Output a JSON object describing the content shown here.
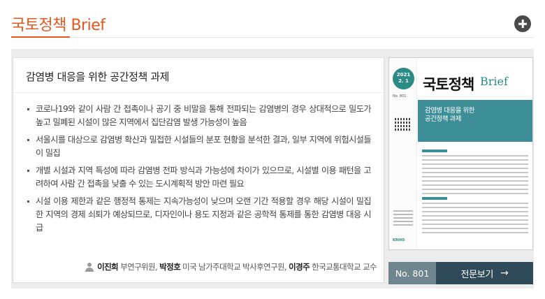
{
  "header": {
    "brand": "국토정책 Brief",
    "more_button": "+"
  },
  "article": {
    "title": "감염병 대응을 위한 공간정책 과제",
    "bullets": [
      "코로나19와 같이 사람 간 접촉이나 공기 중 비말을 통해 전파되는 감염병의 경우 상대적으로 밀도가 높고 밀폐된 시설이 많은 지역에서 집단감염 발생 가능성이 높음",
      "서울시를 대상으로 감염병 확산과 밀접한 시설들의 분포 현황을 분석한 결과, 일부 지역에 위험시설들이 밀집",
      "개별 시설과 지역 특성에 따라 감염병 전파 방식과 가능성에 차이가 있으므로, 시설별 이용 패턴을 고려하여 사람 간 접촉을 낮출 수 있는 도시계획적 방안 마련 필요",
      "시설 이용 제한과 같은 행정적 통제는 지속가능성이 낮으며 오랜 기간 적용할 경우 해당 시설이 밀집한 지역의 경제 쇠퇴가 예상되므로, 디자인이나 용도 지정과 같은 공학적 통제를 통한 감염병 대응 시급"
    ],
    "authors": [
      {
        "name": "이진희",
        "role": "부연구위원,"
      },
      {
        "name": "박정호",
        "role": "미국 남가주대학교 박사후연구원,"
      },
      {
        "name": "이경주",
        "role": "한국교통대학교 교수"
      }
    ]
  },
  "cover": {
    "year": "2021",
    "month": "2. 1",
    "issue_small": "No. 801",
    "title": "국토정책",
    "brief": "Brief",
    "band_text_1": "감염병 대응을 위한",
    "band_text_2": "공간정책 과제",
    "publisher": "KRIHS"
  },
  "issue_bar": {
    "issue_no": "No. 801",
    "full_view": "전문보기",
    "arrow": "→"
  }
}
